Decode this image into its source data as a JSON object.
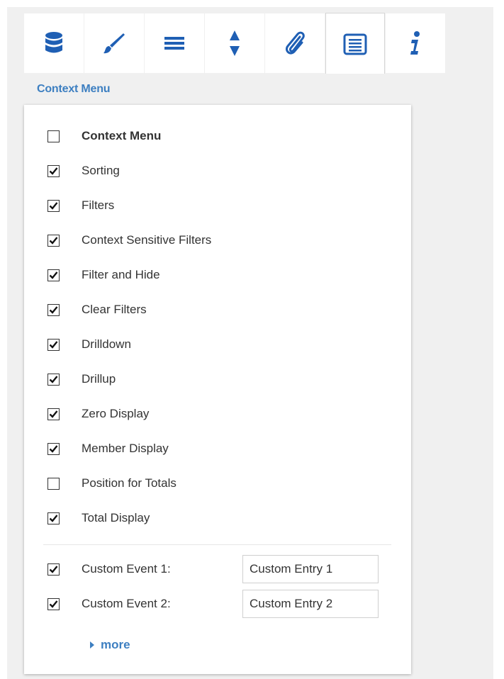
{
  "tabs": [
    {
      "icon": "database-icon",
      "active": false
    },
    {
      "icon": "brush-icon",
      "active": false
    },
    {
      "icon": "menu-lines-icon",
      "active": false
    },
    {
      "icon": "sort-arrows-icon",
      "active": false
    },
    {
      "icon": "paperclip-icon",
      "active": false
    },
    {
      "icon": "list-icon",
      "active": true
    },
    {
      "icon": "info-icon",
      "active": false
    }
  ],
  "section_title": "Context Menu",
  "options": [
    {
      "label": "Context Menu",
      "checked": false,
      "bold": true
    },
    {
      "label": "Sorting",
      "checked": true
    },
    {
      "label": "Filters",
      "checked": true
    },
    {
      "label": "Context Sensitive Filters",
      "checked": true
    },
    {
      "label": "Filter and Hide",
      "checked": true
    },
    {
      "label": "Clear Filters",
      "checked": true
    },
    {
      "label": "Drilldown",
      "checked": true
    },
    {
      "label": "Drillup",
      "checked": true
    },
    {
      "label": "Zero Display",
      "checked": true
    },
    {
      "label": "Member Display",
      "checked": true
    },
    {
      "label": "Position for Totals",
      "checked": false
    },
    {
      "label": "Total Display",
      "checked": true
    }
  ],
  "custom_events": [
    {
      "label": "Custom Event 1:",
      "checked": true,
      "value": "Custom Entry 1"
    },
    {
      "label": "Custom Event 2:",
      "checked": true,
      "value": "Custom Entry 2"
    }
  ],
  "more_label": "more",
  "colors": {
    "accent": "#3d7fc1",
    "icon": "#1f5fb4"
  }
}
